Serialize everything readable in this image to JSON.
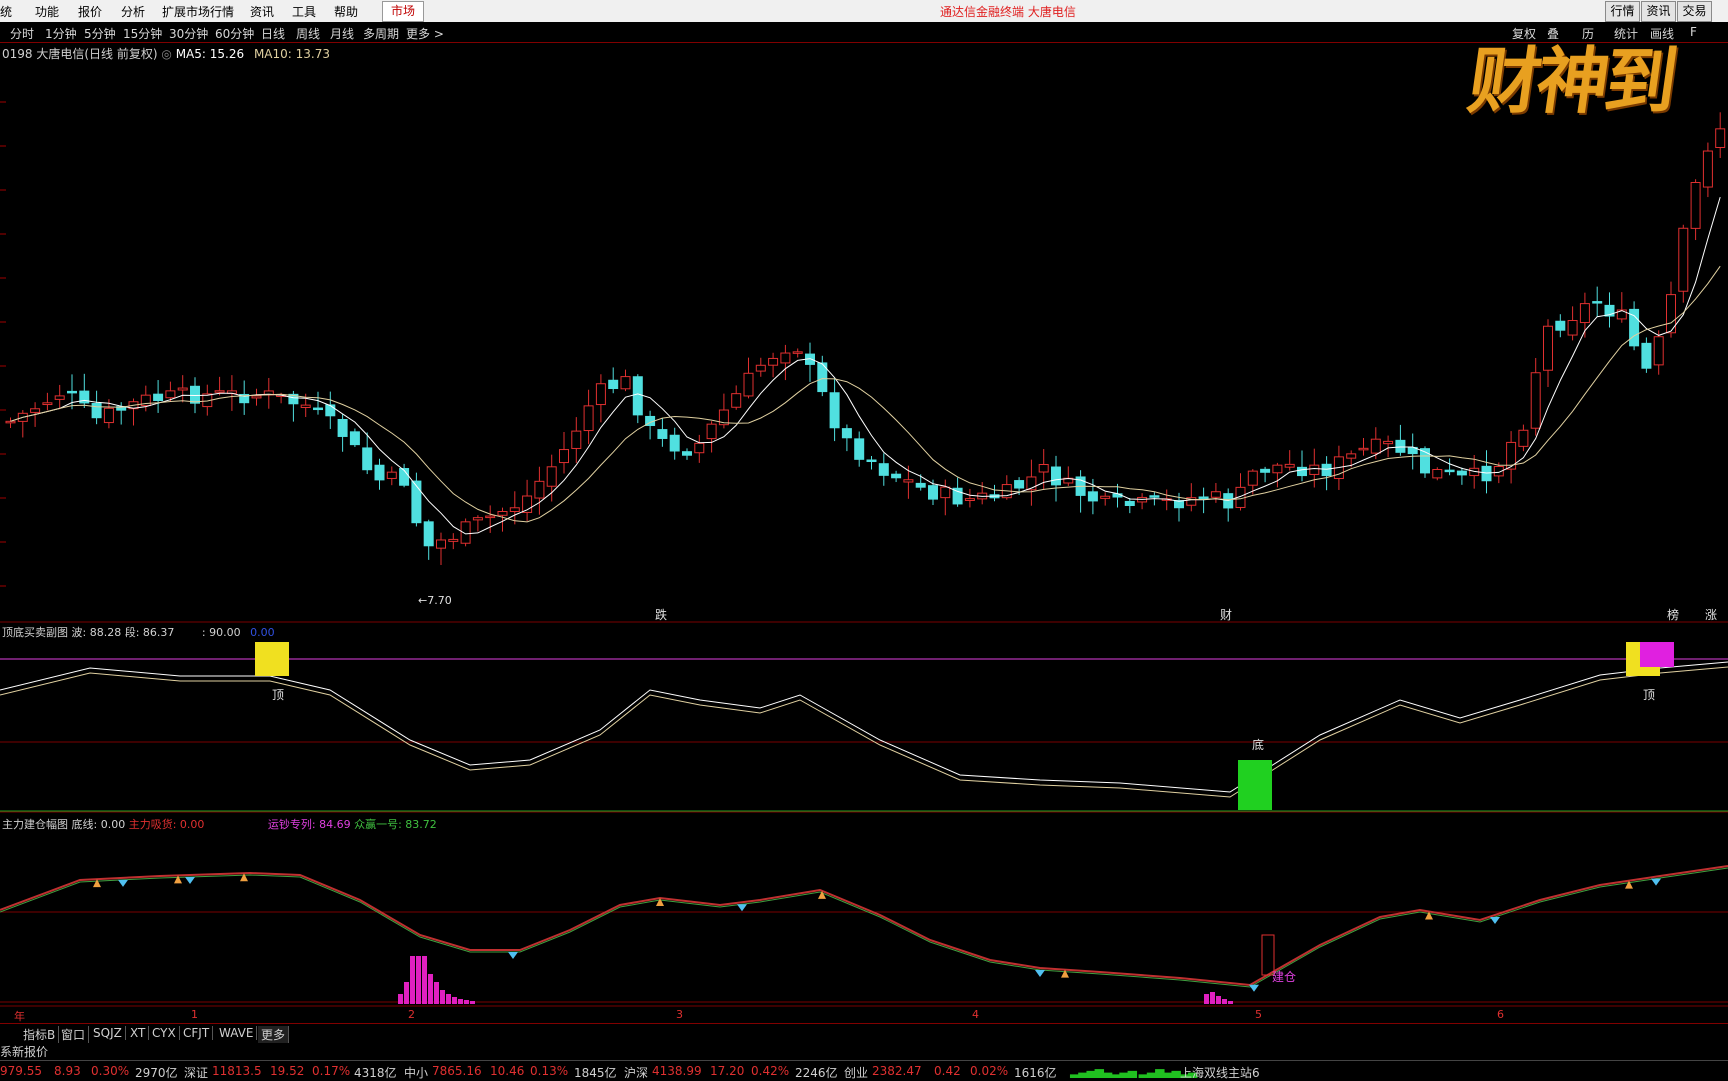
{
  "menu": {
    "items": [
      "统",
      "功能",
      "报价",
      "分析",
      "扩展市场行情",
      "资讯",
      "工具",
      "帮助"
    ],
    "market_button": "市场",
    "app_title": "通达信金融终端  大唐电信",
    "right_buttons": [
      "行情",
      "资讯",
      "交易"
    ]
  },
  "periods": [
    "分时",
    "1分钟",
    "5分钟",
    "15分钟",
    "30分钟",
    "60分钟",
    "日线",
    "周线",
    "月线",
    "多周期",
    "更多 >"
  ],
  "right_tools": [
    "复权",
    "叠",
    "历",
    "统计",
    "画线",
    "F"
  ],
  "stock": {
    "code_name": "0198 大唐电信(日线 前复权)",
    "ma5": "MA5: 15.26",
    "ma10": "MA10: 13.73",
    "low_label": "←7.70",
    "markers": [
      "跌",
      "财",
      "榜",
      "涨"
    ],
    "logo_text": "财神到"
  },
  "indicator1": {
    "title": "顶底买卖副图",
    "bo": "波: 88.28",
    "duan": "段: 86.37",
    "level": ": 90.00",
    "zero": "0.00",
    "labels": [
      "顶",
      "底",
      "顶"
    ],
    "colors": {
      "top_box": "#f0e020",
      "bottom_box": "#20d020",
      "magenta_box": "#e020e0"
    }
  },
  "indicator2": {
    "title": "主力建仓幅图",
    "base": "底线: 0.00",
    "main": "主力吸货: 0.00",
    "yun": "运钞专列: 84.69",
    "zhong": "众赢一号: 83.72",
    "build_label": "建仓"
  },
  "x_axis": [
    "年",
    "1",
    "2",
    "3",
    "4",
    "5",
    "6"
  ],
  "bottom_tabs": [
    "指标B",
    "窗口",
    "SQJZ",
    "XT",
    "CYX",
    "CFJT",
    "WAVE",
    "更多"
  ],
  "quote_label": "系新报价",
  "status": {
    "sh": {
      "value": "979.55",
      "chg": "8.93",
      "pct": "0.30%",
      "amt": "2970亿"
    },
    "sz": {
      "name": "深证",
      "value": "11813.5",
      "chg": "19.52",
      "pct": "0.17%",
      "amt": "4318亿"
    },
    "zx": {
      "name": "中小",
      "value": "7865.16",
      "chg": "10.46",
      "pct": "0.13%",
      "amt": "1845亿"
    },
    "hs": {
      "name": "沪深",
      "value": "4138.99",
      "chg": "17.20",
      "pct": "0.42%",
      "amt": "2246亿"
    },
    "cy": {
      "name": "创业",
      "value": "2382.47",
      "chg": "0.42",
      "pct": "0.02%",
      "amt": "1616亿"
    },
    "server": "上海双线主站6"
  },
  "colors": {
    "up": "#e03030",
    "down": "#50e0e0",
    "ma5": "#ffffff",
    "ma10": "#e0d0a0",
    "grid": "#800000"
  }
}
